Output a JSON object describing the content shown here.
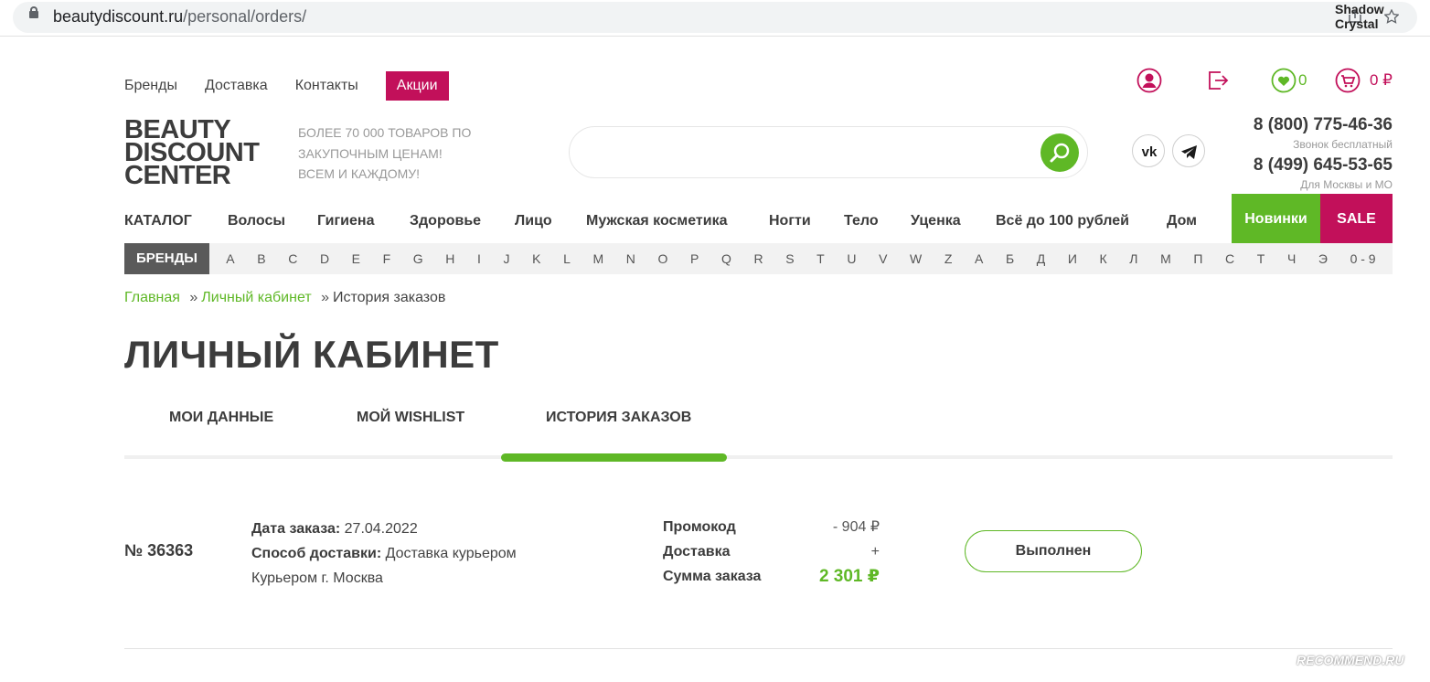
{
  "browser": {
    "url_domain": "beautydiscount.ru",
    "url_path": "/personal/orders/",
    "profile_name": "Shadow Crystal"
  },
  "topnav": {
    "links": [
      "Бренды",
      "Доставка",
      "Контакты"
    ],
    "promo": "Акции",
    "wishlist_count": "0",
    "cart_total": "0 ₽"
  },
  "logo": {
    "line1": "BEAUTY",
    "line2": "DISCOUNT",
    "line3": "CENTER"
  },
  "tagline": [
    "БОЛЕЕ 70 000 ТОВАРОВ ПО",
    "ЗАКУПОЧНЫМ ЦЕНАМ!",
    "ВСЕМ И КАЖДОМУ!"
  ],
  "search": {
    "placeholder": ""
  },
  "contacts": {
    "phone1": "8 (800) 775-46-36",
    "phone1_note": "Звонок бесплатный",
    "phone2": "8 (499) 645-53-65",
    "phone2_note": "Для Москвы и МО"
  },
  "catalog_menu": {
    "items": [
      "КАТАЛОГ",
      "Волосы",
      "Гигиена",
      "Здоровье",
      "Лицо",
      "Мужская косметика",
      "Ногти",
      "Тело",
      "Уценка",
      "Всё до 100 рублей",
      "Дом"
    ],
    "novinki": "Новинки",
    "sale": "SALE"
  },
  "brands": {
    "label": "БРЕНДЫ",
    "letters": [
      "A",
      "B",
      "C",
      "D",
      "E",
      "F",
      "G",
      "H",
      "I",
      "J",
      "K",
      "L",
      "M",
      "N",
      "O",
      "P",
      "Q",
      "R",
      "S",
      "T",
      "U",
      "V",
      "W",
      "Z",
      "А",
      "Б",
      "Д",
      "И",
      "К",
      "Л",
      "М",
      "П",
      "С",
      "Т",
      "Ч",
      "Э",
      "0 - 9"
    ]
  },
  "breadcrumb": {
    "home": "Главная",
    "cabinet": "Личный кабинет",
    "current": "История заказов",
    "separator": "»"
  },
  "page_title": "ЛИЧНЫЙ КАБИНЕТ",
  "tabs": [
    "МОИ ДАННЫЕ",
    "МОЙ WISHLIST",
    "ИСТОРИЯ ЗАКАЗОВ"
  ],
  "order": {
    "number": "№ 36363",
    "date_label": "Дата заказа:",
    "date": "27.04.2022",
    "delivery_label": "Способ доставки:",
    "delivery": "Доставка курьером",
    "delivery_detail": "Курьером г. Москва",
    "promo_label": "Промокод",
    "promo_value": "- 904 ₽",
    "shipping_label": "Доставка",
    "shipping_value": "+",
    "total_label": "Сумма заказа",
    "total_value": "2 301 ₽",
    "status": "Выполнен"
  },
  "watermark": "RECOMMEND.RU",
  "colors": {
    "green": "#5fb826",
    "crimson": "#c2105a"
  }
}
